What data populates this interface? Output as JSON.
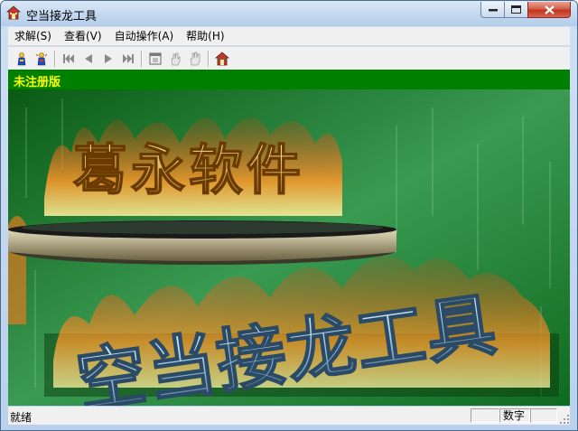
{
  "window": {
    "title": "空当接龙工具"
  },
  "menu": [
    {
      "label": "求解(S)"
    },
    {
      "label": "查看(V)"
    },
    {
      "label": "自动操作(A)"
    },
    {
      "label": "帮助(H)"
    }
  ],
  "toolbar": {
    "icons": [
      "solve-icon",
      "solve-all-icon",
      "first-step-icon",
      "previous-step-icon",
      "next-step-icon",
      "last-step-icon",
      "restore-icon",
      "hand-auto-icon",
      "hand-icon",
      "home-icon"
    ]
  },
  "banner": {
    "text": "未注册版"
  },
  "art": {
    "brand_text": "葛永软件",
    "product_text": "空当接龙工具"
  },
  "status": {
    "text": "就绪",
    "pane_numlock": "数字"
  },
  "colors": {
    "banner_bg": "#008000",
    "banner_text": "#ffff00",
    "board_green": "#0d6b1a",
    "flame": "#ff7a1a"
  }
}
